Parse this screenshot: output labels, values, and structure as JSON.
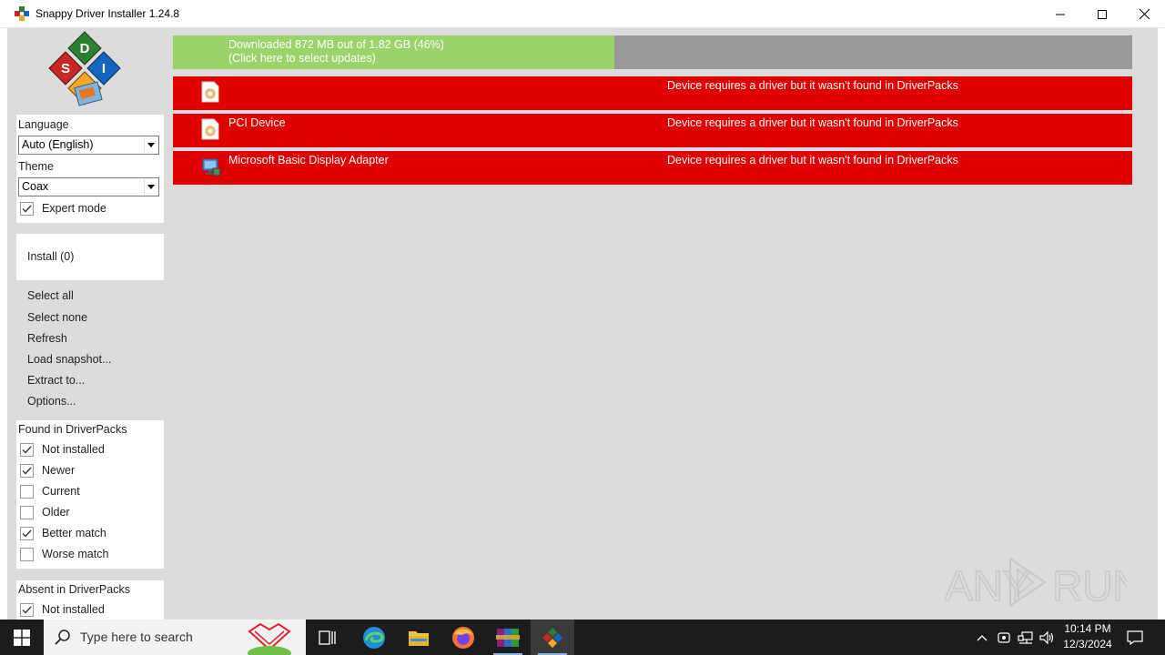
{
  "window": {
    "title": "Snappy Driver Installer 1.24.8"
  },
  "sidebar": {
    "language_label": "Language",
    "language_value": "Auto (English)",
    "theme_label": "Theme",
    "theme_value": "Coax",
    "expert_mode_label": "Expert mode",
    "expert_mode_checked": true,
    "install_label": "Install (0)",
    "actions": [
      "Select all",
      "Select none",
      "Refresh",
      "Load snapshot...",
      "Extract to...",
      "Options..."
    ],
    "found_title": "Found in DriverPacks",
    "found_filters": [
      {
        "label": "Not installed",
        "checked": true
      },
      {
        "label": "Newer",
        "checked": true
      },
      {
        "label": "Current",
        "checked": false
      },
      {
        "label": "Older",
        "checked": false
      },
      {
        "label": "Better match",
        "checked": true
      },
      {
        "label": "Worse match",
        "checked": false
      }
    ],
    "absent_title": "Absent in DriverPacks",
    "absent_filters": [
      {
        "label": "Not installed",
        "checked": true
      }
    ]
  },
  "progress": {
    "line1": "Downloaded 872 MB out of 1.82 GB (46%)",
    "line2": "(Click here to select updates)",
    "fraction": 0.46
  },
  "devices": [
    {
      "name": "",
      "status": "Device requires a driver but it wasn't found in DriverPacks",
      "icon": "device-generic-icon"
    },
    {
      "name": "PCI Device",
      "status": "Device requires a driver but it wasn't found in DriverPacks",
      "icon": "device-generic-icon"
    },
    {
      "name": "Microsoft Basic Display Adapter",
      "status": "Device requires a driver but it wasn't found in DriverPacks",
      "icon": "display-adapter-icon"
    }
  ],
  "watermark": "ANY RUN",
  "taskbar": {
    "search_placeholder": "Type here to search",
    "time": "10:14 PM",
    "date": "12/3/2024"
  },
  "colors": {
    "device_row": "#e00000",
    "progress_fill": "#9bd36b",
    "progress_bg": "#999999",
    "main_bg": "#dcdcdc"
  }
}
